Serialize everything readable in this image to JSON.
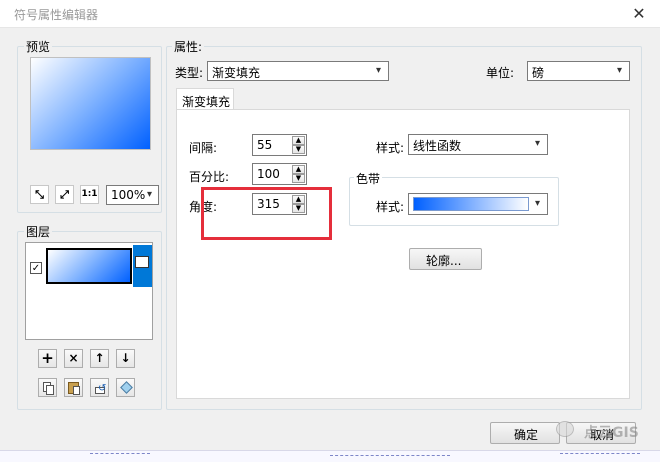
{
  "window": {
    "title": "符号属性编辑器",
    "close_glyph": "✕"
  },
  "preview": {
    "label": "预览",
    "zoom_value": "100%",
    "tools": {
      "zoom_fit": "⤡",
      "zoom_extent": "⤢",
      "actual_size": "1:1"
    }
  },
  "layers": {
    "label": "图层",
    "items": [
      {
        "checked": true
      }
    ],
    "buttons": {
      "add": "+",
      "remove": "×",
      "up": "↑",
      "down": "↓"
    }
  },
  "properties": {
    "label": "属性:",
    "type_label": "类型:",
    "type_value": "渐变填充",
    "unit_label": "单位:",
    "unit_value": "磅",
    "tab_label": "渐变填充",
    "interval_label": "间隔:",
    "interval_value": "55",
    "percent_label": "百分比:",
    "percent_value": "100",
    "angle_label": "角度:",
    "angle_value": "315",
    "style_label": "样式:",
    "style_value": "线性函数",
    "ramp_group_label": "色带",
    "ramp_style_label": "样式:",
    "outline_button": "轮廓..."
  },
  "footer": {
    "ok_label": "确定",
    "cancel_label": "取消"
  },
  "watermark": {
    "text": "点云GIS"
  },
  "colors": {
    "accent_blue": "#0060ff",
    "highlight": "#e52e3b",
    "selection": "#0078d7"
  }
}
